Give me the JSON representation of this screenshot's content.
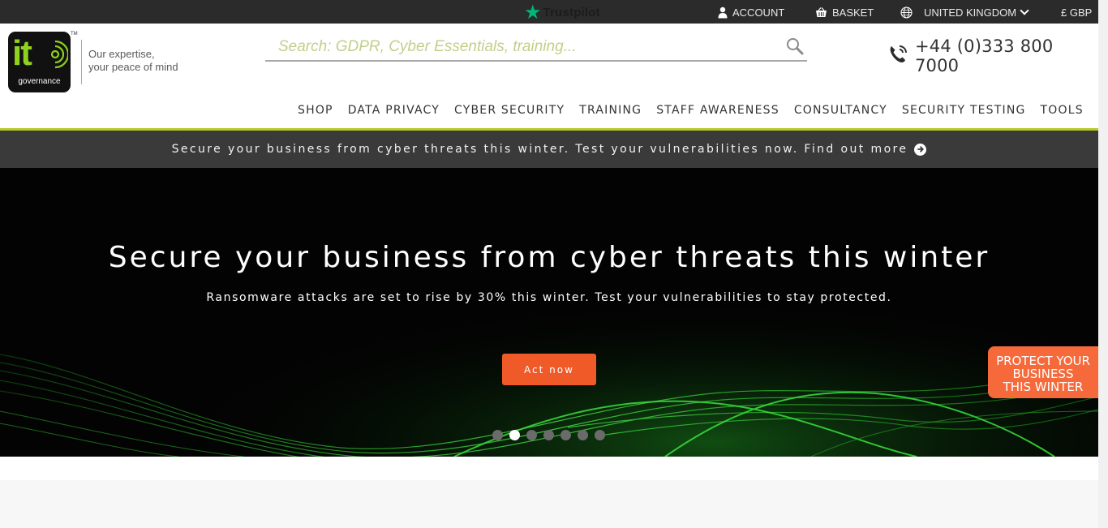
{
  "topbar": {
    "trustpilot": "Trustpilot",
    "account": "ACCOUNT",
    "basket": "BASKET",
    "country": "UNITED KINGDOM",
    "currency": "£ GBP"
  },
  "brand": {
    "logo_text": "it",
    "logo_sub": "governance",
    "trademark": "TM",
    "tagline_line1": "Our expertise,",
    "tagline_line2": "your peace of mind",
    "accent": "#8ed11e"
  },
  "search": {
    "placeholder": "Search: GDPR, Cyber Essentials, training...",
    "value": ""
  },
  "phone": "+44 (0)333 800 7000",
  "nav": [
    "SHOP",
    "DATA PRIVACY",
    "CYBER SECURITY",
    "TRAINING",
    "STAFF AWARENESS",
    "CONSULTANCY",
    "SECURITY TESTING",
    "TOOLS"
  ],
  "promo": {
    "text": "Secure your business from cyber threats this winter. Test your vulnerabilities now. Find out more"
  },
  "hero": {
    "title": "Secure your business from cyber threats this winter",
    "subtitle": "Ransomware attacks are set to rise by 30% this winter. Test your vulnerabilities to stay protected.",
    "cta": "Act now",
    "slide_count": 7,
    "active_slide": 2
  },
  "sidetab": {
    "line1": "PROTECT YOUR",
    "line2": "BUSINESS",
    "line3": "THIS WINTER",
    "color": "#f5693a"
  },
  "colors": {
    "topbar": "#2b2b2b",
    "promo_bg": "#3a3a3a",
    "cta": "#f05a28",
    "trustpilot_star": "#00b67a"
  }
}
